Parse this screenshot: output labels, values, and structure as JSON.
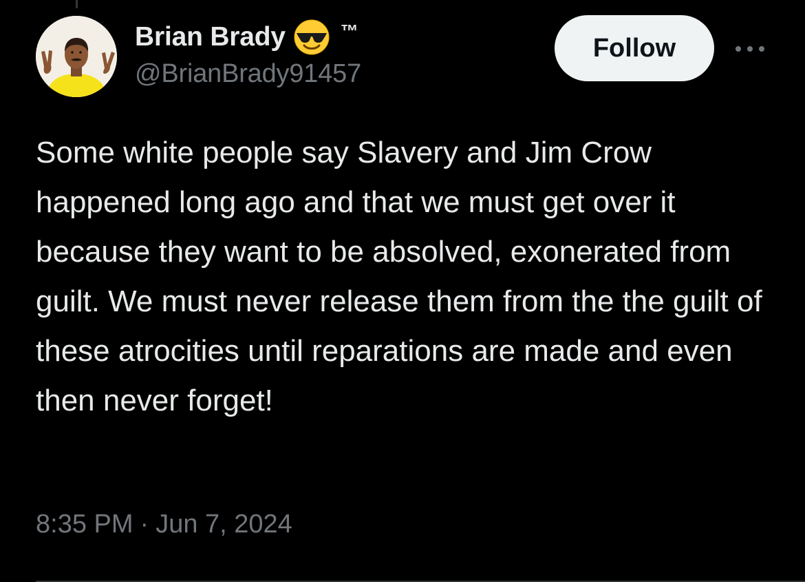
{
  "tweet": {
    "author": {
      "display_name": "Brian Brady",
      "emoji": "smiling-face-with-sunglasses",
      "trademark": "™",
      "handle": "@BrianBrady91457",
      "avatar": "avatar-photo"
    },
    "follow_label": "Follow",
    "more_icon": "more-horizontal-icon",
    "text": "Some white people say Slavery and Jim Crow happened long ago and that we must get over it because they want to be absolved, exonerated from guilt. We must never release them from the the guilt of these atrocities until reparations are made and even then never forget!",
    "time": "8:35 PM",
    "separator": "·",
    "date": "Jun 7, 2024"
  },
  "colors": {
    "background": "#000000",
    "primary_text": "#e7e9ea",
    "secondary_text": "#71767b",
    "follow_button_bg": "#eff3f4",
    "follow_button_text": "#0f1419"
  }
}
